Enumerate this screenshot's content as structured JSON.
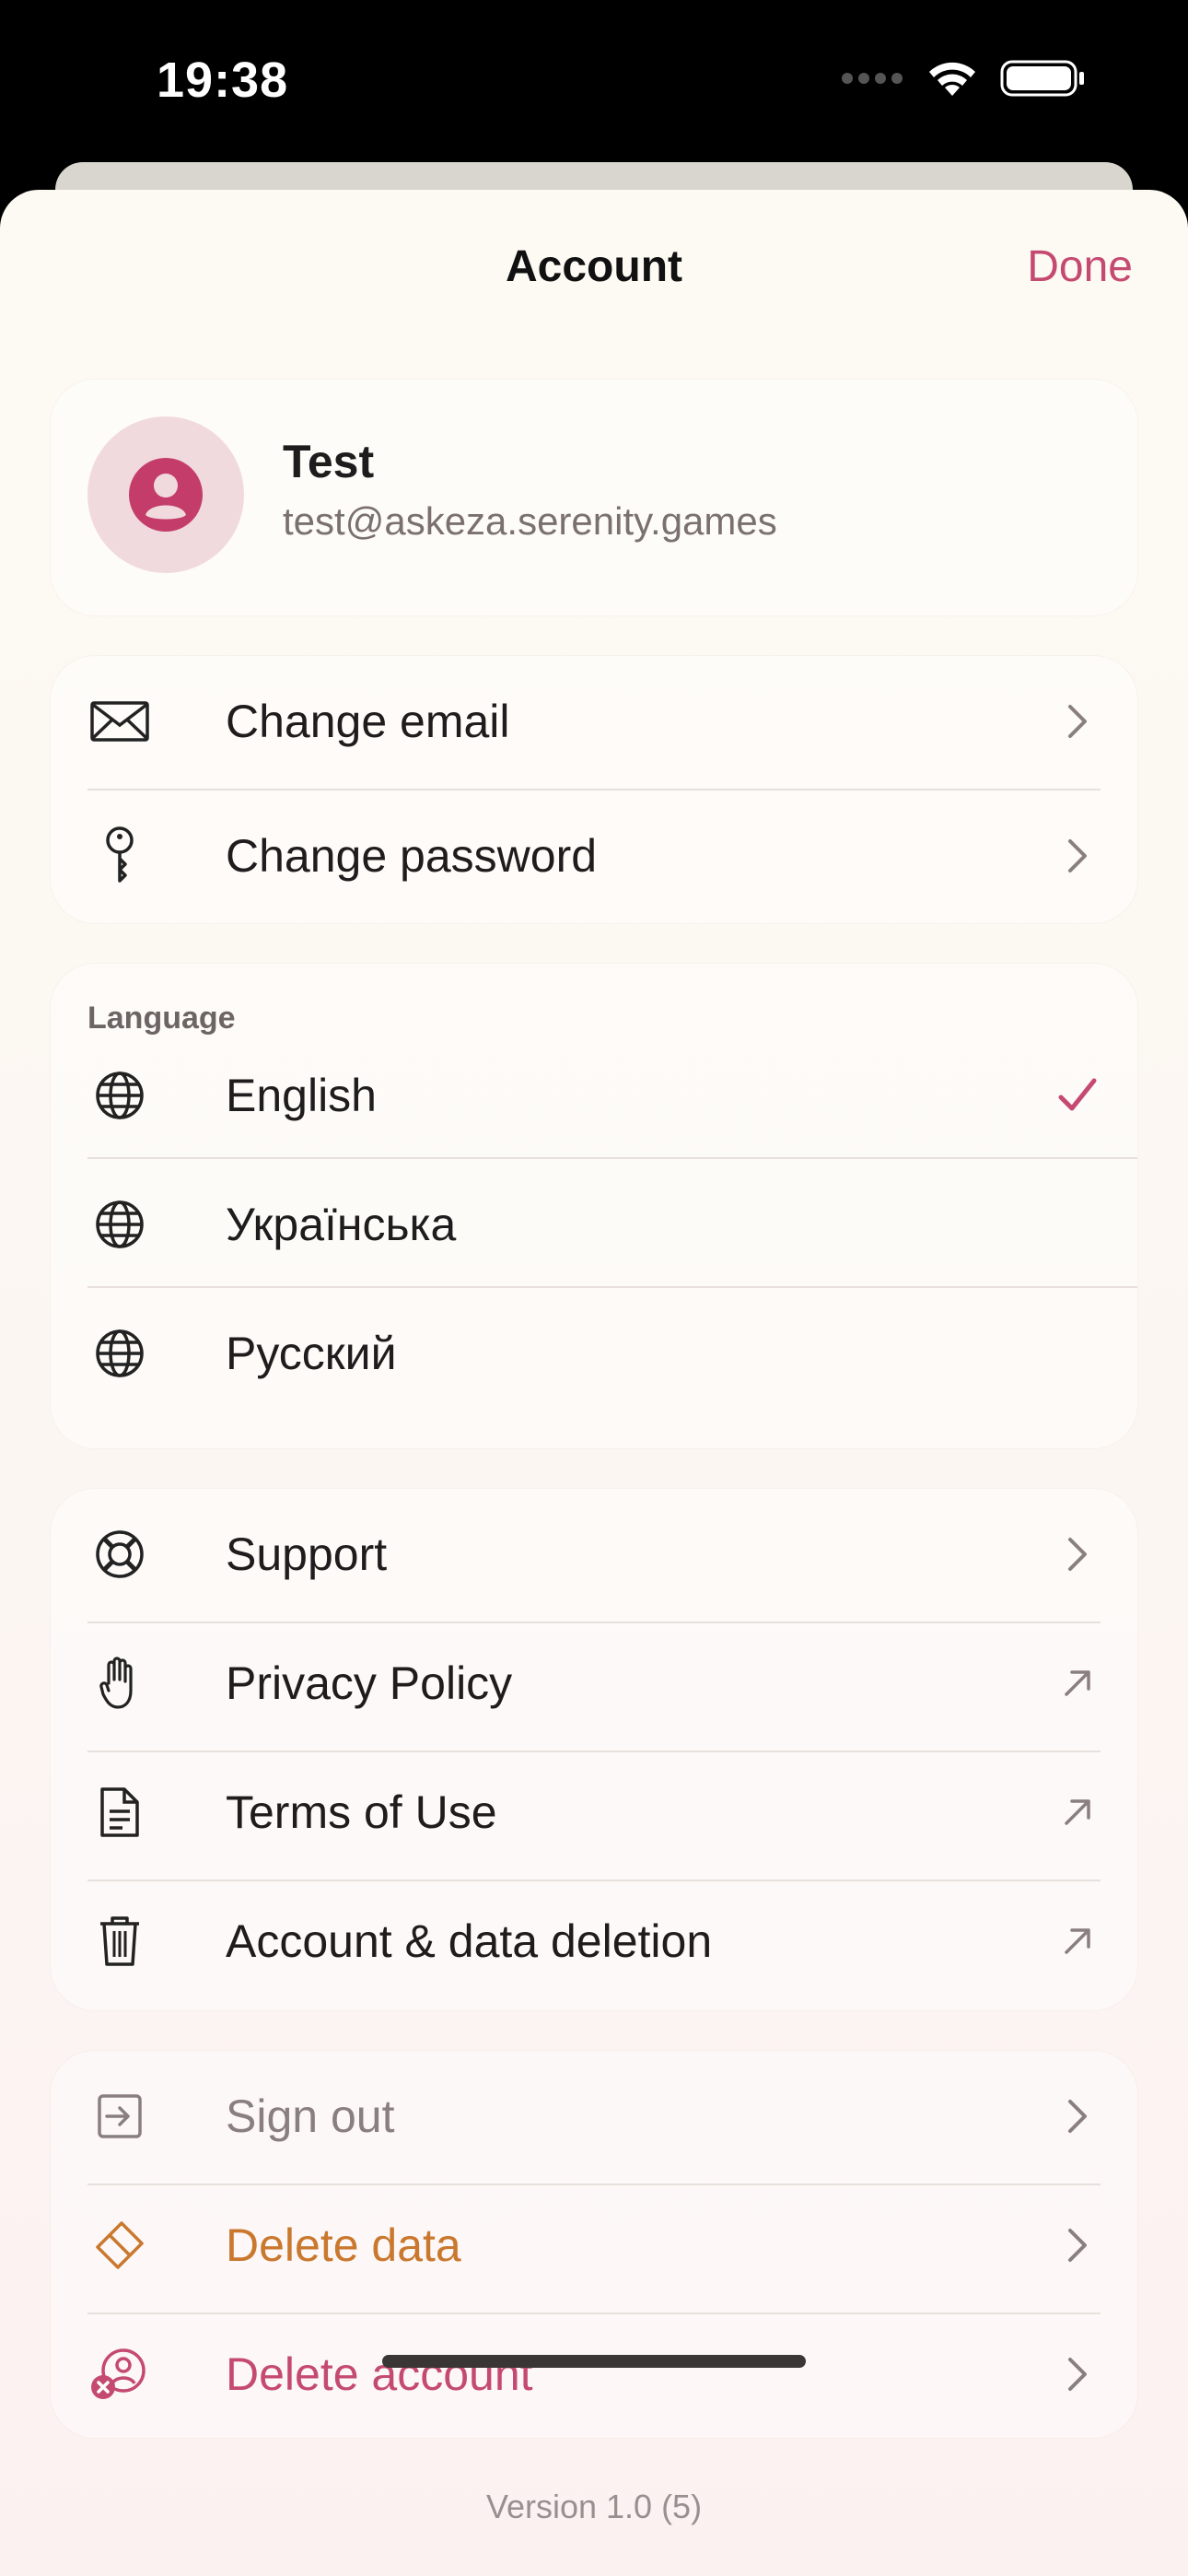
{
  "status_bar": {
    "time": "19:38"
  },
  "nav": {
    "title": "Account",
    "done_label": "Done"
  },
  "profile": {
    "name": "Test",
    "email": "test@askeza.serenity.games"
  },
  "credentials": {
    "items": [
      {
        "label": "Change email",
        "icon": "envelope-icon"
      },
      {
        "label": "Change password",
        "icon": "key-icon"
      }
    ]
  },
  "language": {
    "header": "Language",
    "selected": "English",
    "items": [
      {
        "label": "English",
        "icon": "globe-icon"
      },
      {
        "label": "Українська",
        "icon": "globe-icon"
      },
      {
        "label": "Русский",
        "icon": "globe-icon"
      }
    ]
  },
  "info": {
    "items": [
      {
        "label": "Support",
        "icon": "lifebuoy-icon"
      },
      {
        "label": "Privacy Policy",
        "icon": "hand-icon"
      },
      {
        "label": "Terms of Use",
        "icon": "document-icon"
      },
      {
        "label": "Account & data deletion",
        "icon": "trash-icon"
      }
    ]
  },
  "danger": {
    "items": [
      {
        "label": "Sign out",
        "icon": "sign-out-icon"
      },
      {
        "label": "Delete data",
        "icon": "eraser-icon"
      },
      {
        "label": "Delete account",
        "icon": "delete-account-icon"
      }
    ]
  },
  "version": "Version 1.0 (5)",
  "colors": {
    "accent": "#c54a72",
    "delete_data": "#c9782e",
    "muted": "#8a7f7f",
    "text": "#1e1c1c"
  }
}
